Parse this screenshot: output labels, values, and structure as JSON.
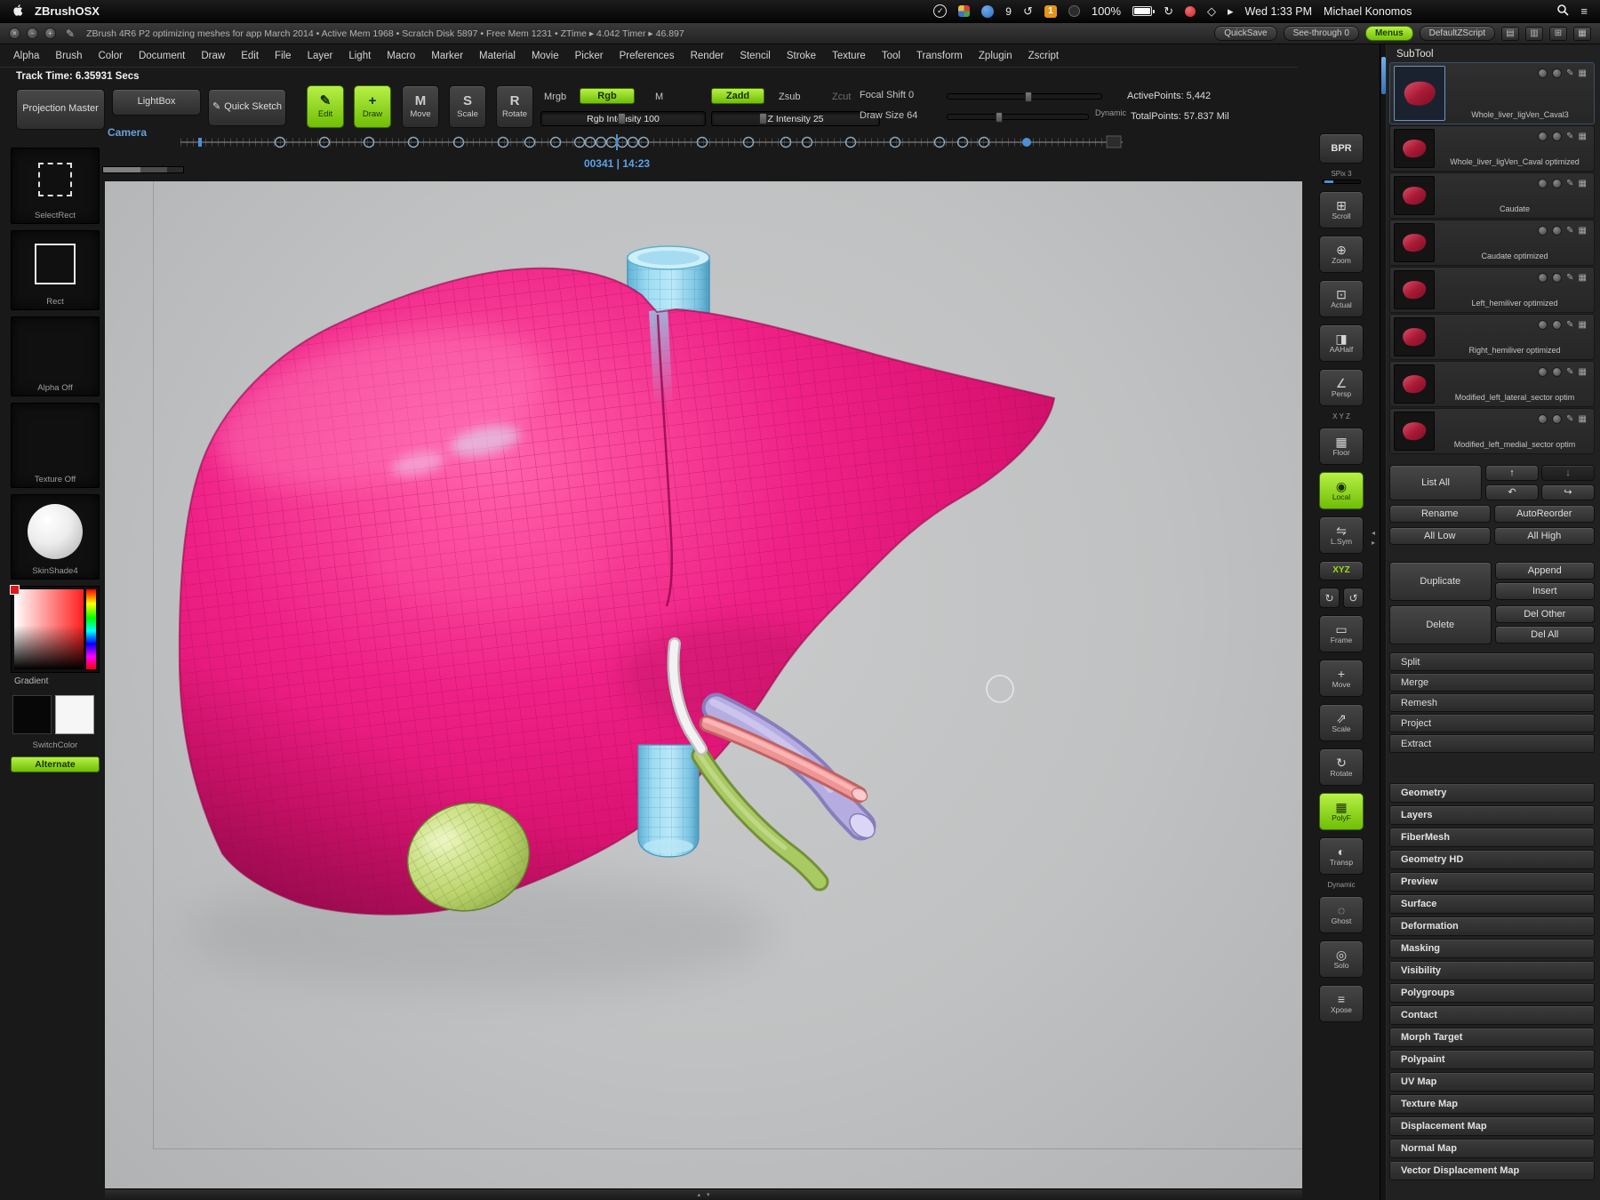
{
  "macbar": {
    "app": "ZBrushOSX",
    "badge_count": "9",
    "badge_one": "1",
    "battery": "100%",
    "clock": "Wed 1:33 PM",
    "user": "Michael Konomos"
  },
  "titlebar": {
    "title": "ZBrush 4R6 P2   optimizing meshes for app March 2014   •  Active Mem 1968  •  Scratch Disk 5897  •  Free Mem 1231  •  ZTime ▸ 4.042   Timer ▸ 46.897",
    "quicksave": "QuickSave",
    "see_through": "See-through 0",
    "menus": "Menus",
    "default_zscript": "DefaultZScript"
  },
  "menu_items": [
    "Alpha",
    "Brush",
    "Color",
    "Document",
    "Draw",
    "Edit",
    "File",
    "Layer",
    "Light",
    "Macro",
    "Marker",
    "Material",
    "Movie",
    "Picker",
    "Preferences",
    "Render",
    "Stencil",
    "Stroke",
    "Texture",
    "Tool",
    "Transform",
    "Zplugin",
    "Zscript"
  ],
  "track_time": "Track Time: 6.35931 Secs",
  "toolbar": {
    "projection_master": "Projection Master",
    "lightbox": "LightBox",
    "quick_sketch": "Quick Sketch",
    "edit": "Edit",
    "draw": "Draw",
    "move": "Move",
    "scale": "Scale",
    "rotate": "Rotate",
    "move_glyph": "M",
    "scale_glyph": "S",
    "rotate_glyph": "R",
    "mrgb": "Mrgb",
    "rgb": "Rgb",
    "m": "M",
    "zadd": "Zadd",
    "zsub": "Zsub",
    "zcut": "Zcut",
    "rgb_intensity": "Rgb Intensity 100",
    "z_intensity": "Z Intensity 25",
    "focal_shift": "Focal Shift 0",
    "draw_size": "Draw Size 64",
    "dynamic": "Dynamic",
    "active_points": "ActivePoints: 5,442",
    "total_points": "TotalPoints: 57.837 Mil"
  },
  "timeline": {
    "camera": "Camera",
    "frame_display": "00341 | 14:23"
  },
  "left_panel": {
    "selectrect": "SelectRect",
    "rect": "Rect",
    "alpha": "Alpha Off",
    "texture": "Texture Off",
    "material": "SkinShade4",
    "gradient": "Gradient",
    "switchcolor": "SwitchColor",
    "alternate": "Alternate"
  },
  "right_strip": {
    "bpr": "BPR",
    "spix": "SPix 3",
    "scroll": "Scroll",
    "zoom": "Zoom",
    "actual": "Actual",
    "aahalf": "AAHalf",
    "persp": "Persp",
    "floor": "Floor",
    "micro_xyz": "X Y Z",
    "local": "Local",
    "lsym": "L.Sym",
    "xyz": "XYZ",
    "frame": "Frame",
    "move": "Move",
    "scale": "Scale",
    "rotate": "Rotate",
    "polyf": "PolyF",
    "transp": "Transp",
    "micro_dynamic": "Dynamic",
    "ghost": "Ghost",
    "solo": "Solo",
    "xpose": "Xpose"
  },
  "subtool": {
    "header": "SubTool",
    "items": [
      {
        "name": "Whole_liver_ligVen_Caval3",
        "selected": true
      },
      {
        "name": "Whole_liver_ligVen_Caval optimized"
      },
      {
        "name": "Caudate"
      },
      {
        "name": "Caudate optimized"
      },
      {
        "name": "Left_hemiliver optimized"
      },
      {
        "name": "Right_hemiliver optimized"
      },
      {
        "name": "Modified_left_lateral_sector optim"
      },
      {
        "name": "Modified_left_medial_sector optim"
      }
    ],
    "list_all": "List All",
    "rename": "Rename",
    "autoreorder": "AutoReorder",
    "all_low": "All Low",
    "all_high": "All High",
    "duplicate": "Duplicate",
    "append": "Append",
    "insert": "Insert",
    "delete": "Delete",
    "del_other": "Del Other",
    "del_all": "Del All",
    "sections": [
      "Split",
      "Merge",
      "Remesh",
      "Project",
      "Extract"
    ]
  },
  "tool_sections": [
    "Geometry",
    "Layers",
    "FiberMesh",
    "Geometry HD",
    "Preview",
    "Surface",
    "Deformation",
    "Masking",
    "Visibility",
    "Polygroups",
    "Contact",
    "Morph Target",
    "Polypaint",
    "UV Map",
    "Texture Map",
    "Displacement Map",
    "Normal Map",
    "Vector Displacement Map"
  ],
  "colors": {
    "accent_green": "#96e01a",
    "liver_pink": "#ee1b7f",
    "vessel_cyan": "#8ed7f0",
    "gallbladder_green": "#bcd56e",
    "artery_salmon": "#ee9696",
    "vein_lavender": "#b5ace0",
    "duct_green": "#a9c961",
    "timeline_blue": "#4a90d9"
  }
}
